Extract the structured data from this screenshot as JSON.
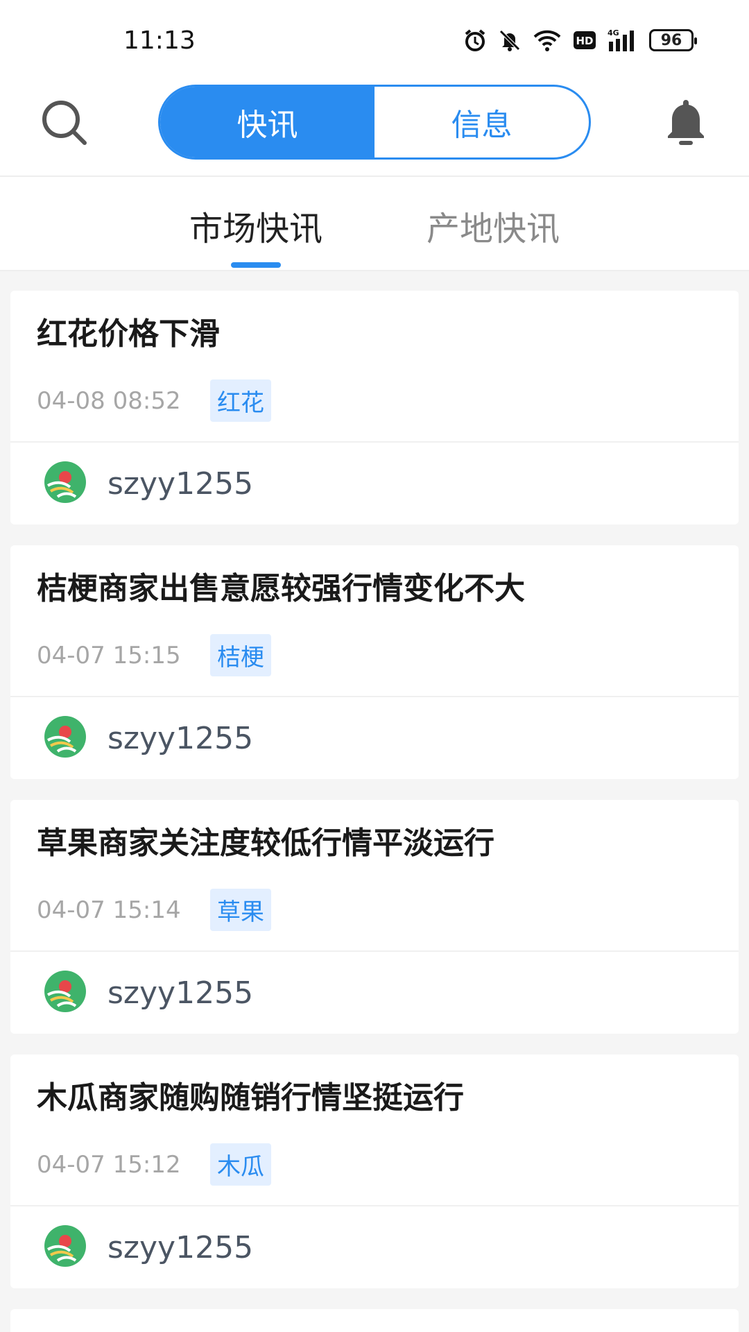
{
  "status_bar": {
    "time": "11:13",
    "battery": "96",
    "icons": [
      "alarm-icon",
      "mute-bell-icon",
      "wifi-icon",
      "hd-icon",
      "4g-signal-icon",
      "battery-icon"
    ]
  },
  "header": {
    "segments": [
      {
        "label": "快讯",
        "active": true
      },
      {
        "label": "信息",
        "active": false
      }
    ]
  },
  "tabs": [
    {
      "label": "市场快讯",
      "active": true
    },
    {
      "label": "产地快讯",
      "active": false
    }
  ],
  "news": [
    {
      "title": "红花价格下滑",
      "time": "04-08 08:52",
      "tag": "红花",
      "author": "szyy1255"
    },
    {
      "title": "桔梗商家出售意愿较强行情变化不大",
      "time": "04-07 15:15",
      "tag": "桔梗",
      "author": "szyy1255"
    },
    {
      "title": "草果商家关注度较低行情平淡运行",
      "time": "04-07 15:14",
      "tag": "草果",
      "author": "szyy1255"
    },
    {
      "title": "木瓜商家随购随销行情坚挺运行",
      "time": "04-07 15:12",
      "tag": "木瓜",
      "author": "szyy1255"
    }
  ],
  "colors": {
    "accent": "#2a8cf0",
    "tag_bg": "#e3efff",
    "background": "#f5f5f5"
  }
}
